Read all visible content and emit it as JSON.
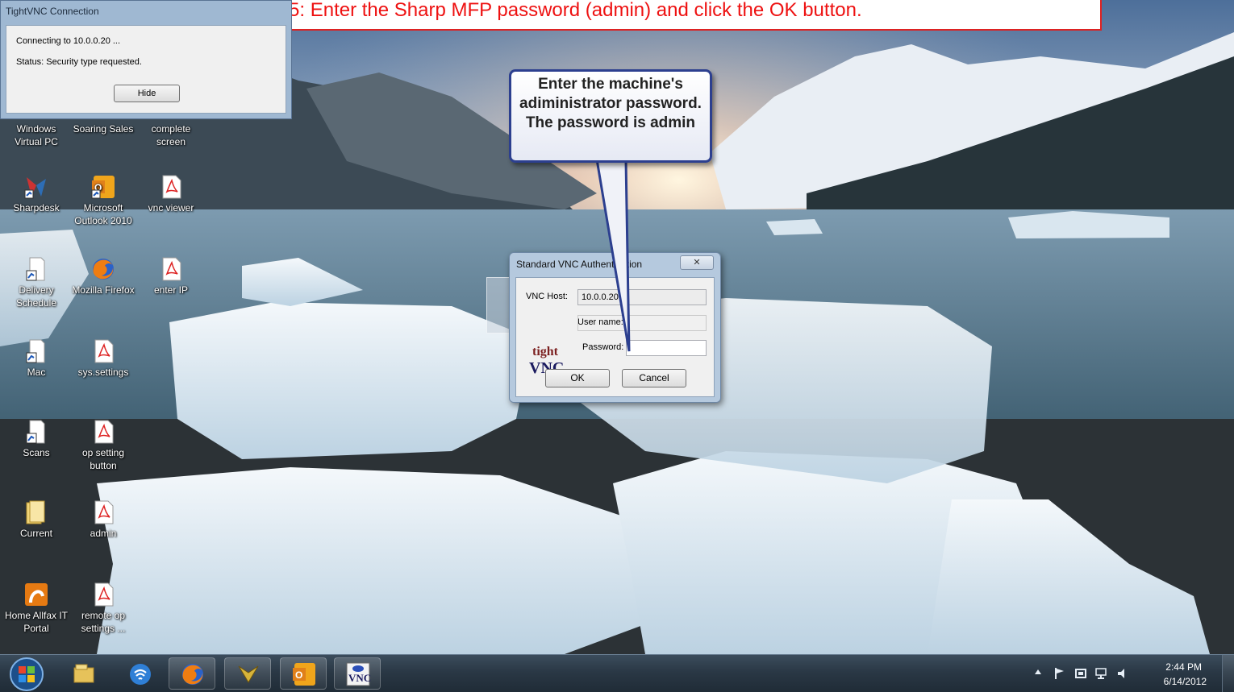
{
  "banner": {
    "text": "Step 5: Enter the Sharp MFP password (admin) and click the OK button."
  },
  "conn_window": {
    "title": "TightVNC Connection",
    "line1": "Connecting to 10.0.0.20 ...",
    "line2": "Status: Security type requested.",
    "hide_label": "Hide"
  },
  "desktop_icons": [
    {
      "label": "Windows Virtual PC"
    },
    {
      "label": "Soaring Sales"
    },
    {
      "label": "complete screen"
    },
    {
      "label": "Sharpdesk"
    },
    {
      "label": "Microsoft Outlook 2010"
    },
    {
      "label": "vnc viewer"
    },
    {
      "label": "Delivery Schedule"
    },
    {
      "label": "Mozilla Firefox"
    },
    {
      "label": "enter IP"
    },
    {
      "label": "Mac"
    },
    {
      "label": "sys.settings"
    },
    {
      "label": "Scans"
    },
    {
      "label": "op setting button"
    },
    {
      "label": "Current"
    },
    {
      "label": "admin"
    },
    {
      "label": "Home Allfax IT Portal"
    },
    {
      "label": "remote op settings ..."
    }
  ],
  "callout": {
    "text": "Enter the machine's adiministrator password. The password is admin"
  },
  "auth_dialog": {
    "title": "Standard VNC Authentication",
    "close_glyph": "✕",
    "host_label": "VNC Host:",
    "host_value": "10.0.0.20",
    "user_label": "User name:",
    "user_value": "",
    "password_label": "Password:",
    "password_value": "",
    "ok_label": "OK",
    "cancel_label": "Cancel",
    "logo_text_top": "tight",
    "logo_text_bottom": "VNC"
  },
  "taskbar": {
    "buttons": [
      {
        "icon": "explorer-icon"
      },
      {
        "icon": "network-icon"
      },
      {
        "icon": "firefox-icon"
      },
      {
        "icon": "sharpdesk-icon"
      },
      {
        "icon": "outlook-icon"
      },
      {
        "icon": "tightvnc-icon"
      }
    ],
    "time": "2:44 PM",
    "date": "6/14/2012"
  }
}
